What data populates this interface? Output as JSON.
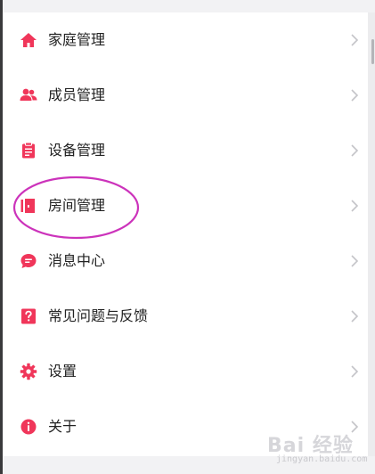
{
  "menu": {
    "items": [
      {
        "label": "家庭管理",
        "icon": "home-icon"
      },
      {
        "label": "成员管理",
        "icon": "members-icon"
      },
      {
        "label": "设备管理",
        "icon": "device-icon"
      },
      {
        "label": "房间管理",
        "icon": "room-door-icon"
      },
      {
        "label": "消息中心",
        "icon": "message-icon"
      },
      {
        "label": "常见问题与反馈",
        "icon": "question-icon"
      },
      {
        "label": "设置",
        "icon": "gear-icon"
      },
      {
        "label": "关于",
        "icon": "info-icon"
      }
    ]
  },
  "watermark": {
    "text": "Bai 经验",
    "sub": "jingyan.baidu.com"
  },
  "colors": {
    "accent": "#f0365a",
    "highlight": "#cc33bb",
    "chevron": "#c4c4c8"
  }
}
